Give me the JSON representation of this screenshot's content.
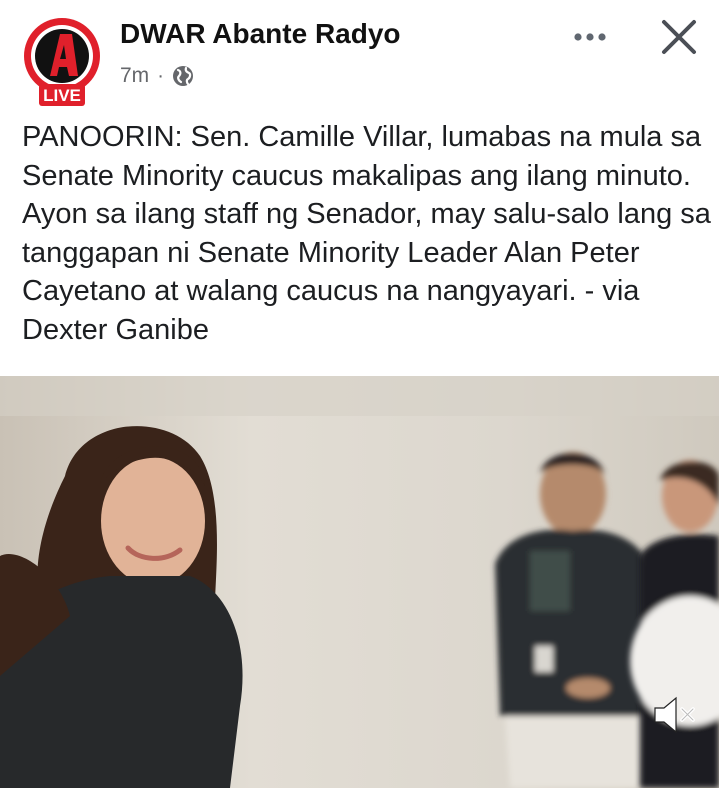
{
  "post": {
    "page_name": "DWAR Abante Radyo",
    "timestamp": "7m",
    "separator": "·",
    "audience_icon": "globe-icon",
    "avatar": {
      "logo_letter": "A",
      "badge_text": "LIVE",
      "brand_color": "#e0202b"
    },
    "text": "PANOORIN: Sen. Camille Villar, lumabas na mula sa Senate Minority caucus makalipas ang ilang minuto. Ayon sa ilang staff ng Senador, may salu-salo lang sa tanggapan ni Senate Minority Leader Alan Peter Cayetano at walang caucus na nangyayari. - via Dexter Ganibe"
  },
  "controls": {
    "more_icon": "more-horizontal-icon",
    "close_icon": "close-icon",
    "mute_icon": "speaker-muted-icon"
  },
  "video": {
    "state": "muted"
  }
}
